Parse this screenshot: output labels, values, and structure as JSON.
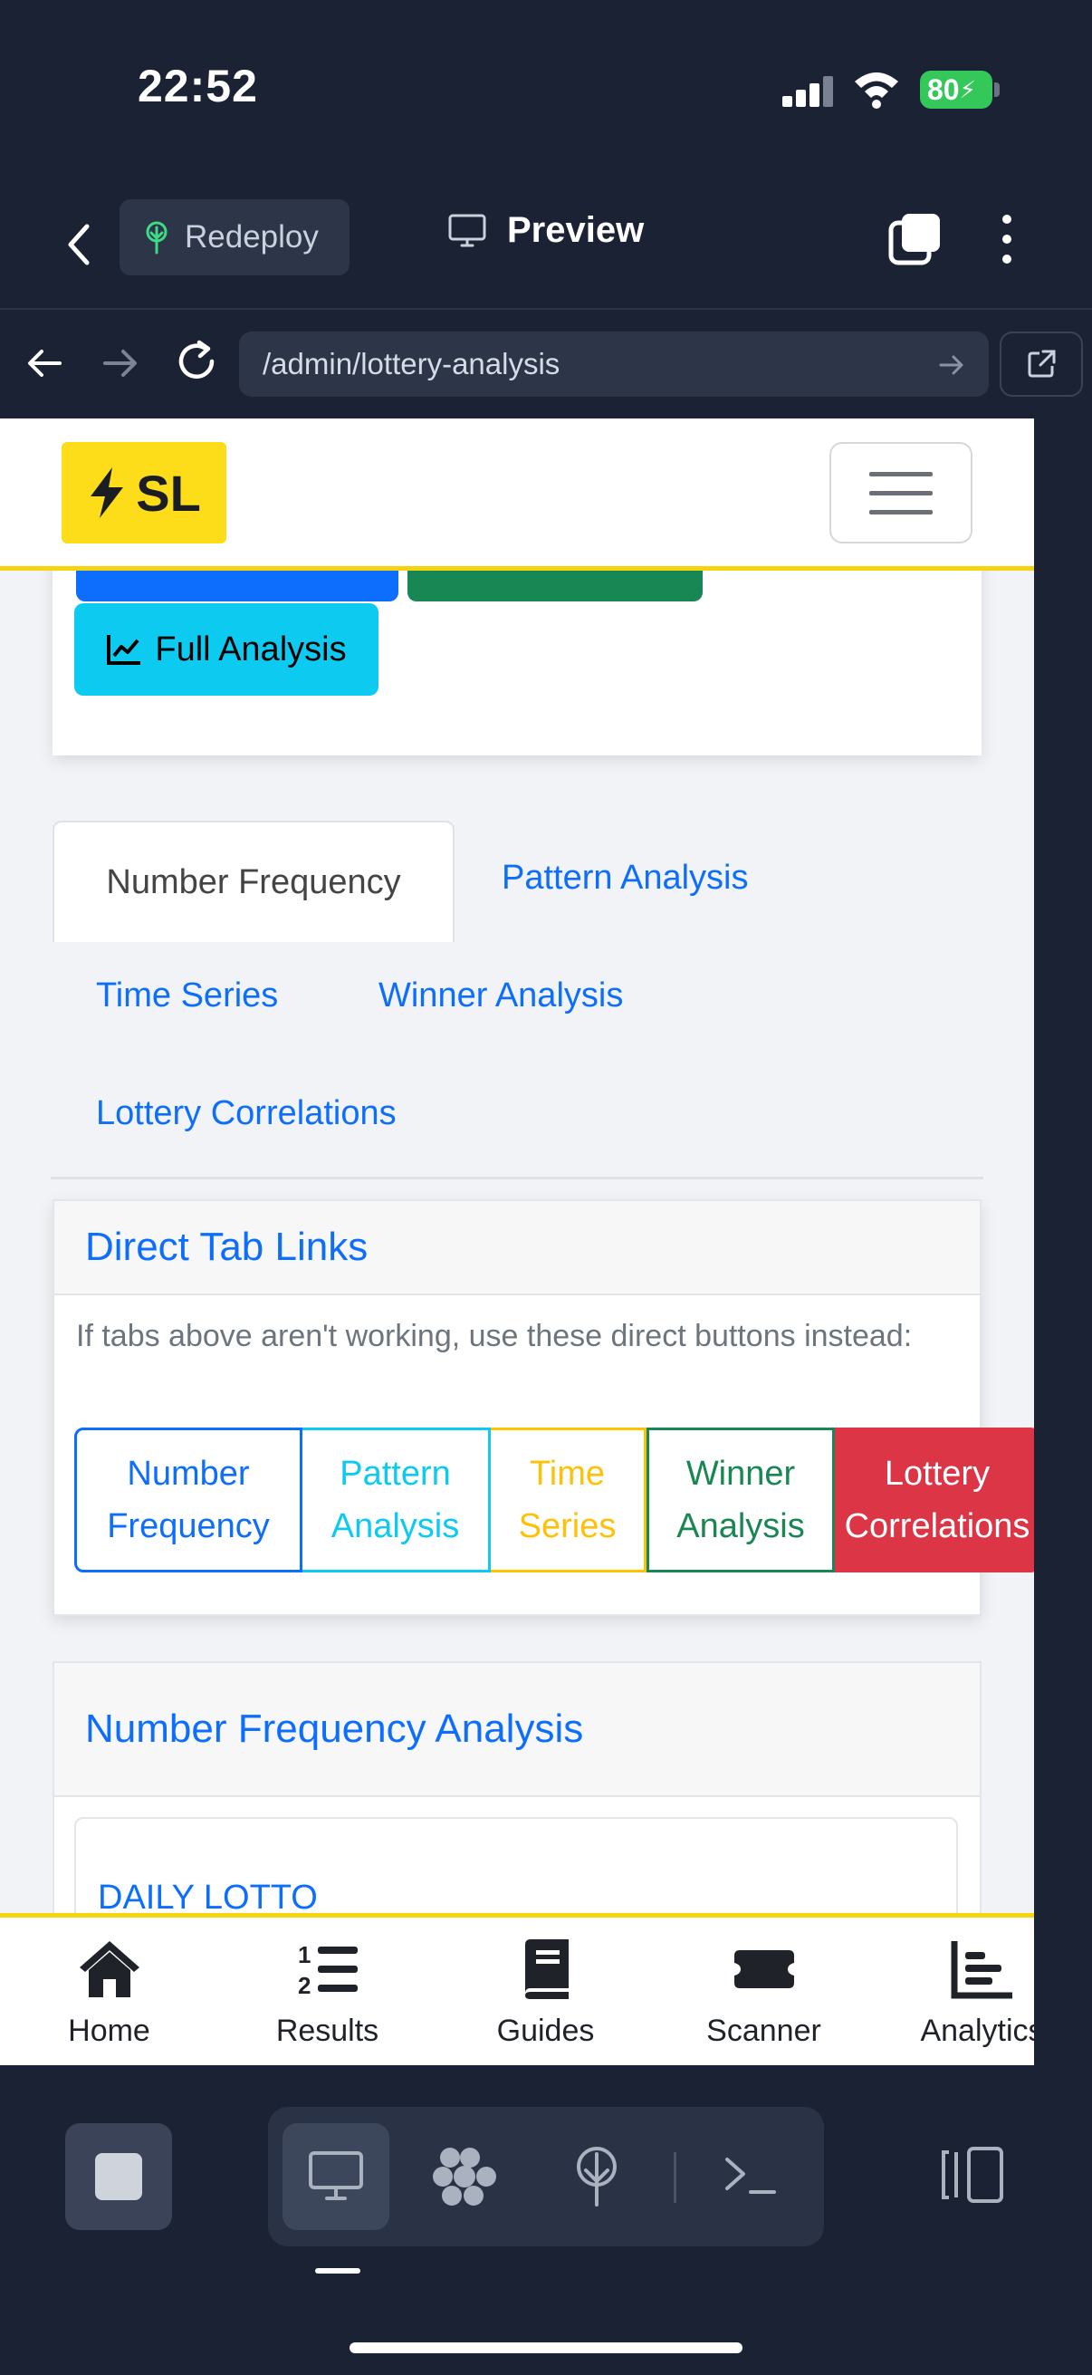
{
  "status_bar": {
    "time": "22:52",
    "battery": "80"
  },
  "ide": {
    "redeploy_label": "Redeploy",
    "preview_label": "Preview",
    "url": "/admin/lottery-analysis"
  },
  "site": {
    "logo_text": "SL",
    "buttons": {
      "full_analysis": "Full Analysis"
    },
    "tabs": [
      {
        "label": "Number Frequency",
        "active": true
      },
      {
        "label": "Pattern Analysis",
        "active": false
      },
      {
        "label": "Time Series",
        "active": false
      },
      {
        "label": "Winner Analysis",
        "active": false
      },
      {
        "label": "Lottery Correlations",
        "active": false
      }
    ],
    "direct_links": {
      "title": "Direct Tab Links",
      "note": "If tabs above aren't working, use these direct buttons instead:",
      "buttons": [
        {
          "line1": "Number",
          "line2": "Frequency",
          "color": "#0d6efd"
        },
        {
          "line1": "Pattern",
          "line2": "Analysis",
          "color": "#0dcaf0"
        },
        {
          "line1": "Time",
          "line2": "Series",
          "color": "#ffc107"
        },
        {
          "line1": "Winner",
          "line2": "Analysis",
          "color": "#198754"
        },
        {
          "line1": "Lottery",
          "line2": "Correlations",
          "color": "#dc3545"
        }
      ]
    },
    "frequency": {
      "title": "Number Frequency Analysis",
      "lottery": "DAILY LOTTO"
    },
    "bottom_nav": [
      {
        "label": "Home",
        "icon": "home-icon"
      },
      {
        "label": "Results",
        "icon": "numbered-list-icon"
      },
      {
        "label": "Guides",
        "icon": "book-icon"
      },
      {
        "label": "Scanner",
        "icon": "ticket-icon"
      },
      {
        "label": "Analytics",
        "icon": "bar-chart-icon"
      }
    ]
  },
  "colors": {
    "accent": "#0d6efd",
    "brand_yellow": "#fddc1a",
    "chrome_bg": "#1b2233"
  }
}
